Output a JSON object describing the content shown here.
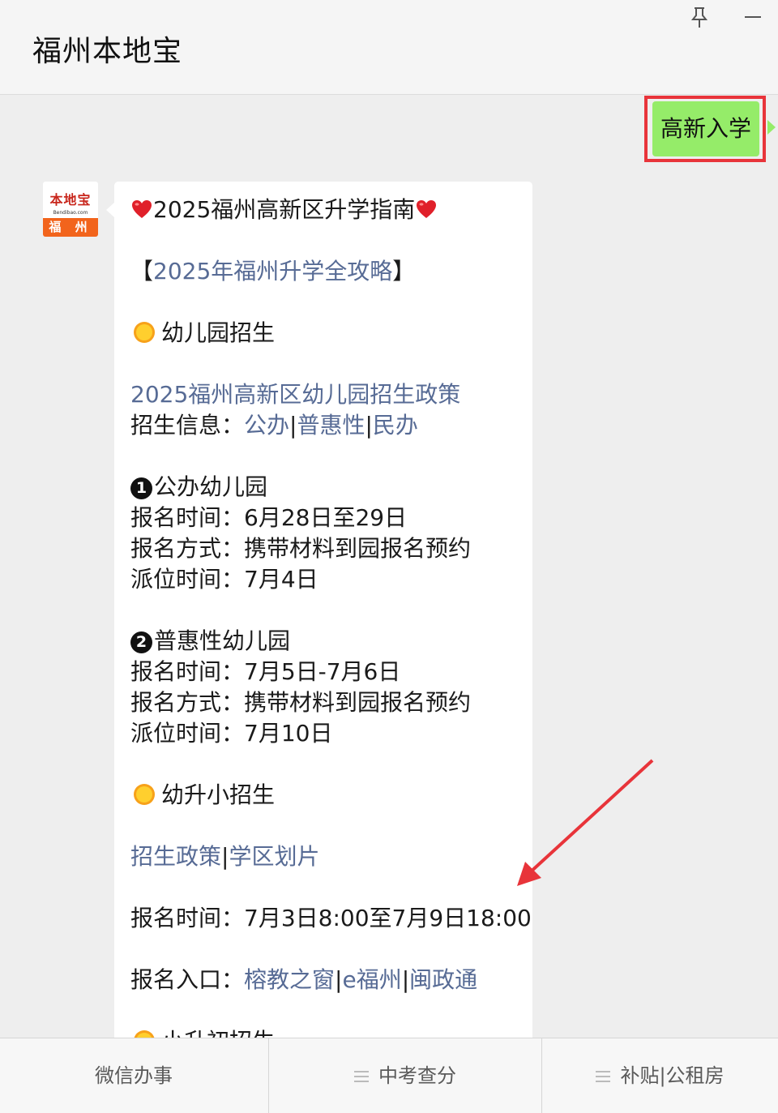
{
  "window": {
    "title": "福州本地宝",
    "pin_icon": "pin-icon",
    "minimize_icon": "minimize-icon"
  },
  "sent_message": {
    "text": "高新入学",
    "bubble_color": "#95ec69",
    "highlight_color": "#e8343a"
  },
  "avatar": {
    "name": "本地宝",
    "domain": "Bendibao.com",
    "city": "福 州"
  },
  "reply": {
    "title": "2025福州高新区升学指南",
    "guide_open": "【",
    "guide_link": "2025年福州升学全攻略",
    "guide_close": "】",
    "kindergarten": {
      "heading": "幼儿园招生",
      "policy_link": "2025福州高新区幼儿园招生政策",
      "info_label": "招生信息：",
      "info_links": [
        "公办",
        "普惠性",
        "民办"
      ],
      "public": {
        "heading": "公办幼儿园",
        "num": "1",
        "reg_time": "报名时间：6月28日至29日",
        "reg_method": "报名方式：携带材料到园报名预约",
        "assign_time": "派位时间：7月4日"
      },
      "inclusive": {
        "heading": "普惠性幼儿园",
        "num": "2",
        "reg_time": "报名时间：7月5日-7月6日",
        "reg_method": "报名方式：携带材料到园报名预约",
        "assign_time": "派位时间：7月10日"
      }
    },
    "primary": {
      "heading": "幼升小招生",
      "links": [
        "招生政策",
        "学区划片"
      ],
      "reg_time": "报名时间：7月3日8:00至7月9日18:00",
      "entry_label": "报名入口：",
      "entry_links": [
        "榕教之窗",
        "e福州",
        "闽政通"
      ]
    },
    "middle": {
      "heading": "小升初招生"
    },
    "separator": "|",
    "link_color": "#576b95"
  },
  "annotation": {
    "arrow_color": "#e8343a"
  },
  "bottom_menu": {
    "items": [
      {
        "label": "微信办事",
        "icon": ""
      },
      {
        "label": "中考查分",
        "icon": "menu-icon"
      },
      {
        "label": "补贴|公租房",
        "icon": "menu-icon"
      }
    ]
  }
}
